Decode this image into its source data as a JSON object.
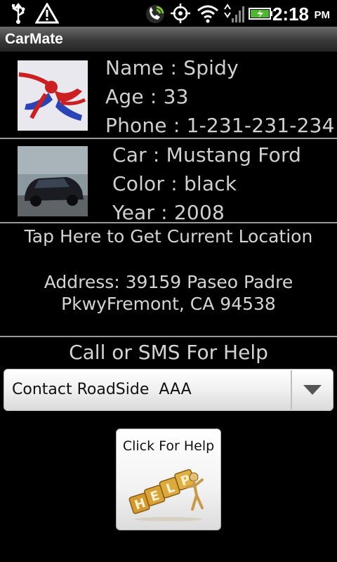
{
  "status_bar": {
    "time": "2:18",
    "ampm": "PM",
    "icons": [
      "usb-icon",
      "warning-icon",
      "phone-icon",
      "gps-icon",
      "wifi-icon",
      "signal-icon",
      "battery-icon"
    ]
  },
  "app": {
    "title": "CarMate"
  },
  "person": {
    "photo": "spiderman-avatar",
    "name_line": "Name : Spidy",
    "age_line": "Age : 33",
    "phone_line": "Phone : 1-231-231-234"
  },
  "car": {
    "photo": "car-photo",
    "car_line": "Car : Mustang Ford",
    "color_line": "Color : black",
    "year_line": "Year : 2008"
  },
  "location": {
    "button_label": "Tap Here to Get Current Location",
    "address_line1": "Address: 39159 Paseo Padre",
    "address_line2": "PkwyFremont, CA 94538"
  },
  "help": {
    "heading": "Call or SMS For Help",
    "contact_selected": "Contact RoadSide  AAA",
    "button_label": "Click For Help",
    "button_icon": "help-graphic-icon"
  },
  "colors": {
    "background": "#000000",
    "text": "#d0d0d0",
    "titlebar": "#3a3a3a",
    "help_art": "#c89028"
  }
}
